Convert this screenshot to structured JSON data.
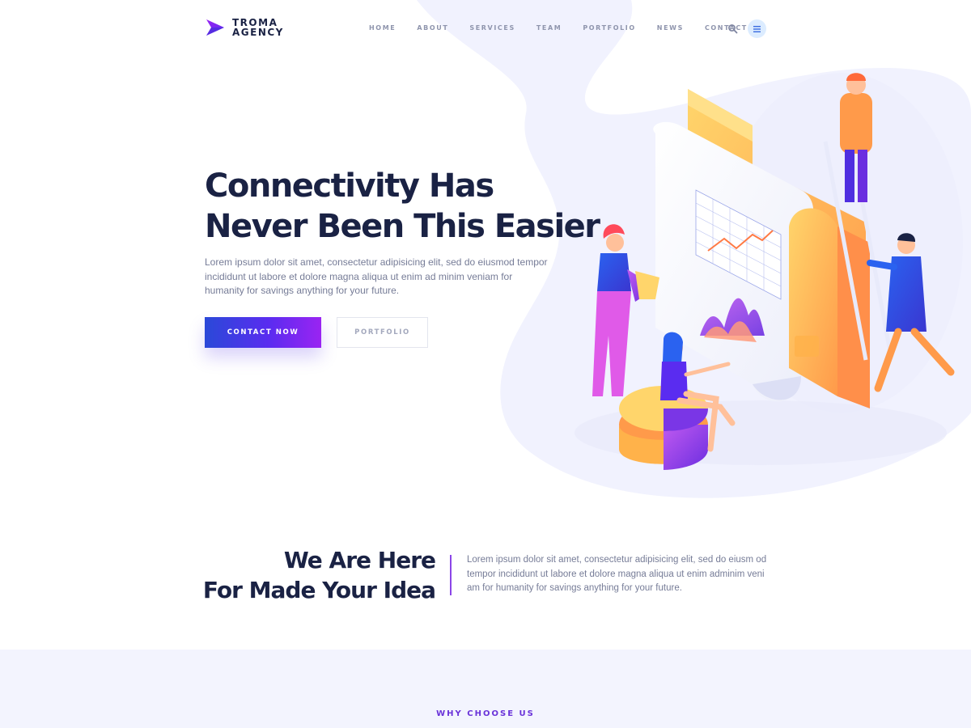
{
  "brand": {
    "line1": "TROMA",
    "line2": "AGENCY",
    "accent_color": "#6a33d9",
    "logo_icon": "arrow-logo-icon"
  },
  "nav": {
    "items": [
      {
        "label": "HOME"
      },
      {
        "label": "ABOUT"
      },
      {
        "label": "SERVICES"
      },
      {
        "label": "TEAM"
      },
      {
        "label": "PORTFOLIO"
      },
      {
        "label": "NEWS"
      },
      {
        "label": "CONTACT"
      }
    ],
    "search_icon": "search-icon",
    "menu_icon": "hamburger-menu-icon"
  },
  "hero": {
    "title_line1": "Connectivity Has",
    "title_line2": "Never Been This Easier",
    "text": "Lorem ipsum dolor sit amet, consectetur adipisicing elit, sed do eiusmod tempor incididunt ut labore et dolore magna aliqua ut enim ad minim veniam for humanity for savings anything for your future.",
    "primary_button": "CONTACT NOW",
    "secondary_button": "PORTFOLIO",
    "gradient_colors": [
      "#2a49d8",
      "#5a2cf0",
      "#9a24f2"
    ]
  },
  "intro": {
    "title_line1": "We Are Here",
    "title_line2": "For Made Your Idea",
    "text": "Lorem ipsum dolor sit amet, consectetur adipisicing elit, sed do eiusm od tempor incididunt ut labore et dolore magna aliqua ut enim adminim veni am for humanity for savings anything for your future."
  },
  "why": {
    "label": "WHY CHOOSE US",
    "background_color": "#f3f4fe"
  }
}
